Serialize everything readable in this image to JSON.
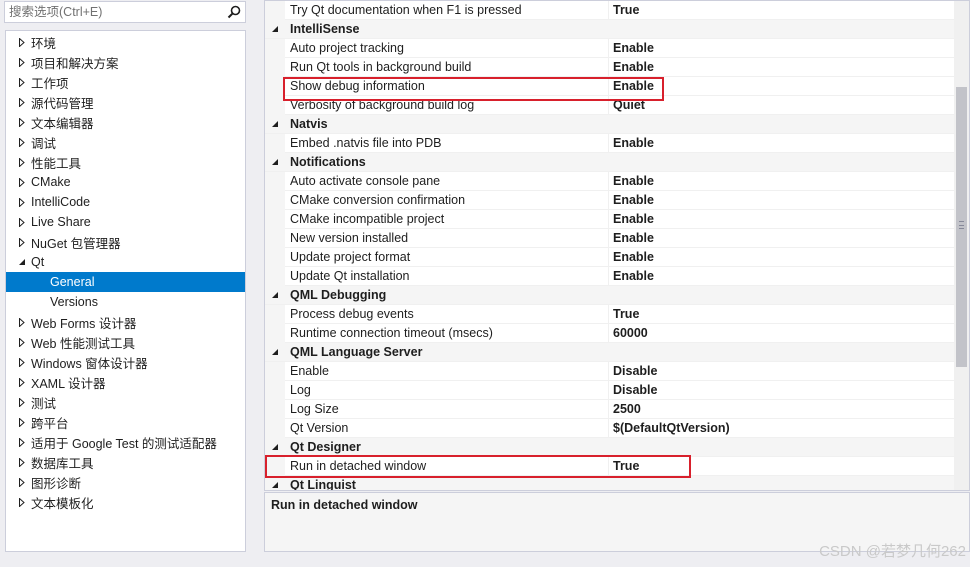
{
  "search": {
    "placeholder": "搜索选项(Ctrl+E)"
  },
  "tree": [
    {
      "label": "环境",
      "level": 0,
      "expanded": false
    },
    {
      "label": "项目和解决方案",
      "level": 0,
      "expanded": false
    },
    {
      "label": "工作项",
      "level": 0,
      "expanded": false
    },
    {
      "label": "源代码管理",
      "level": 0,
      "expanded": false
    },
    {
      "label": "文本编辑器",
      "level": 0,
      "expanded": false
    },
    {
      "label": "调试",
      "level": 0,
      "expanded": false
    },
    {
      "label": "性能工具",
      "level": 0,
      "expanded": false
    },
    {
      "label": "CMake",
      "level": 0,
      "expanded": false
    },
    {
      "label": "IntelliCode",
      "level": 0,
      "expanded": false
    },
    {
      "label": "Live Share",
      "level": 0,
      "expanded": false
    },
    {
      "label": "NuGet 包管理器",
      "level": 0,
      "expanded": false
    },
    {
      "label": "Qt",
      "level": 0,
      "expanded": true
    },
    {
      "label": "General",
      "level": 1,
      "selected": true
    },
    {
      "label": "Versions",
      "level": 1
    },
    {
      "label": "Web Forms 设计器",
      "level": 0,
      "expanded": false
    },
    {
      "label": "Web 性能测试工具",
      "level": 0,
      "expanded": false
    },
    {
      "label": "Windows 窗体设计器",
      "level": 0,
      "expanded": false
    },
    {
      "label": "XAML 设计器",
      "level": 0,
      "expanded": false
    },
    {
      "label": "测试",
      "level": 0,
      "expanded": false
    },
    {
      "label": "跨平台",
      "level": 0,
      "expanded": false
    },
    {
      "label": "适用于 Google Test 的测试适配器",
      "level": 0,
      "expanded": false
    },
    {
      "label": "数据库工具",
      "level": 0,
      "expanded": false
    },
    {
      "label": "图形诊断",
      "level": 0,
      "expanded": false
    },
    {
      "label": "文本模板化",
      "level": 0,
      "expanded": false
    }
  ],
  "grid": [
    {
      "type": "prop",
      "name": "Try Qt documentation when F1 is pressed",
      "value": "True"
    },
    {
      "type": "category",
      "name": "IntelliSense"
    },
    {
      "type": "prop",
      "name": "Auto project tracking",
      "value": "Enable"
    },
    {
      "type": "prop",
      "name": "Run Qt tools in background build",
      "value": "Enable"
    },
    {
      "type": "prop",
      "name": "Show debug information",
      "value": "Enable",
      "highlighted": true
    },
    {
      "type": "prop",
      "name": "Verbosity of background build log",
      "value": "Quiet"
    },
    {
      "type": "category",
      "name": "Natvis"
    },
    {
      "type": "prop",
      "name": "Embed .natvis file into PDB",
      "value": "Enable"
    },
    {
      "type": "category",
      "name": "Notifications"
    },
    {
      "type": "prop",
      "name": "Auto activate console pane",
      "value": "Enable"
    },
    {
      "type": "prop",
      "name": "CMake conversion confirmation",
      "value": "Enable"
    },
    {
      "type": "prop",
      "name": "CMake incompatible project",
      "value": "Enable"
    },
    {
      "type": "prop",
      "name": "New version installed",
      "value": "Enable"
    },
    {
      "type": "prop",
      "name": "Update project format",
      "value": "Enable"
    },
    {
      "type": "prop",
      "name": "Update Qt installation",
      "value": "Enable"
    },
    {
      "type": "category",
      "name": "QML Debugging"
    },
    {
      "type": "prop",
      "name": "Process debug events",
      "value": "True"
    },
    {
      "type": "prop",
      "name": "Runtime connection timeout (msecs)",
      "value": "60000"
    },
    {
      "type": "category",
      "name": "QML Language Server"
    },
    {
      "type": "prop",
      "name": "Enable",
      "value": "Disable"
    },
    {
      "type": "prop",
      "name": "Log",
      "value": "Disable"
    },
    {
      "type": "prop",
      "name": "Log Size",
      "value": "2500"
    },
    {
      "type": "prop",
      "name": "Qt Version",
      "value": "$(DefaultQtVersion)"
    },
    {
      "type": "category",
      "name": "Qt Designer"
    },
    {
      "type": "prop",
      "name": "Run in detached window",
      "value": "True",
      "highlighted": true
    },
    {
      "type": "category",
      "name": "Qt Linguist"
    }
  ],
  "description": {
    "title": "Run in detached window"
  },
  "watermark": "CSDN @若梦几何262",
  "colors": {
    "selection": "#007acc",
    "highlight": "#d8202c"
  }
}
